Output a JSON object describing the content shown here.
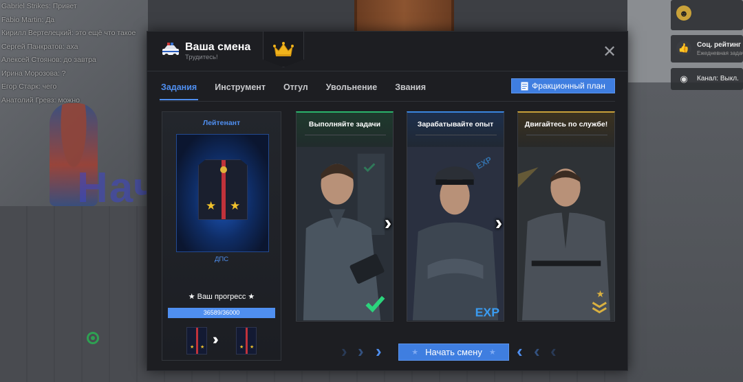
{
  "chat": {
    "lines": [
      "Gabriel Strikes: Привет",
      "Fabio Martin: Да",
      "Кирилл Вертелецкий: это ещё что такое",
      "Сергей Панкратов: аха",
      "Алексей Стоянов: до завтра",
      "Ирина Морозова: ?",
      "Егор Старк: чего",
      "Анатолий Гревз: можно"
    ]
  },
  "background": {
    "big_text": "Нач"
  },
  "hud": {
    "rating_title": "Соц. рейтинг",
    "rating_sub": "Ежедневная задача",
    "channel_label": "Канал: Выкл."
  },
  "modal": {
    "title": "Ваша смена",
    "subtitle": "Трудитесь!",
    "close_symbol": "✕",
    "tabs": [
      "Задания",
      "Инструмент",
      "Отгул",
      "Увольнение",
      "Звания"
    ],
    "active_tab": 0,
    "plan_button": "Фракционный план",
    "rank": {
      "title": "Лейтенант",
      "department": "ДПС",
      "progress_label": "★ Ваш прогресс ★",
      "progress_text": "36589/36000",
      "progress_fraction": 1.0
    },
    "tasks": [
      {
        "title": "Выполняйте задачи",
        "badge": "✔",
        "accent": "#2bb56d"
      },
      {
        "title": "Зарабатывайте опыт",
        "badge": "EXP",
        "accent": "#3a86e0"
      },
      {
        "title": "Двигайтесь по службе!",
        "badge": "★",
        "accent": "#c9a23a"
      }
    ],
    "start_button": "Начать смену"
  },
  "colors": {
    "accent_blue": "#4f8ff0",
    "button_blue": "#3f7ee0",
    "crown_gold": "#f0b31c",
    "stripe_red": "#c0323a"
  },
  "icons": {
    "car": "police-car-icon",
    "crown": "crown-icon",
    "close": "close-icon",
    "plan": "document-icon",
    "star": "star-icon"
  }
}
